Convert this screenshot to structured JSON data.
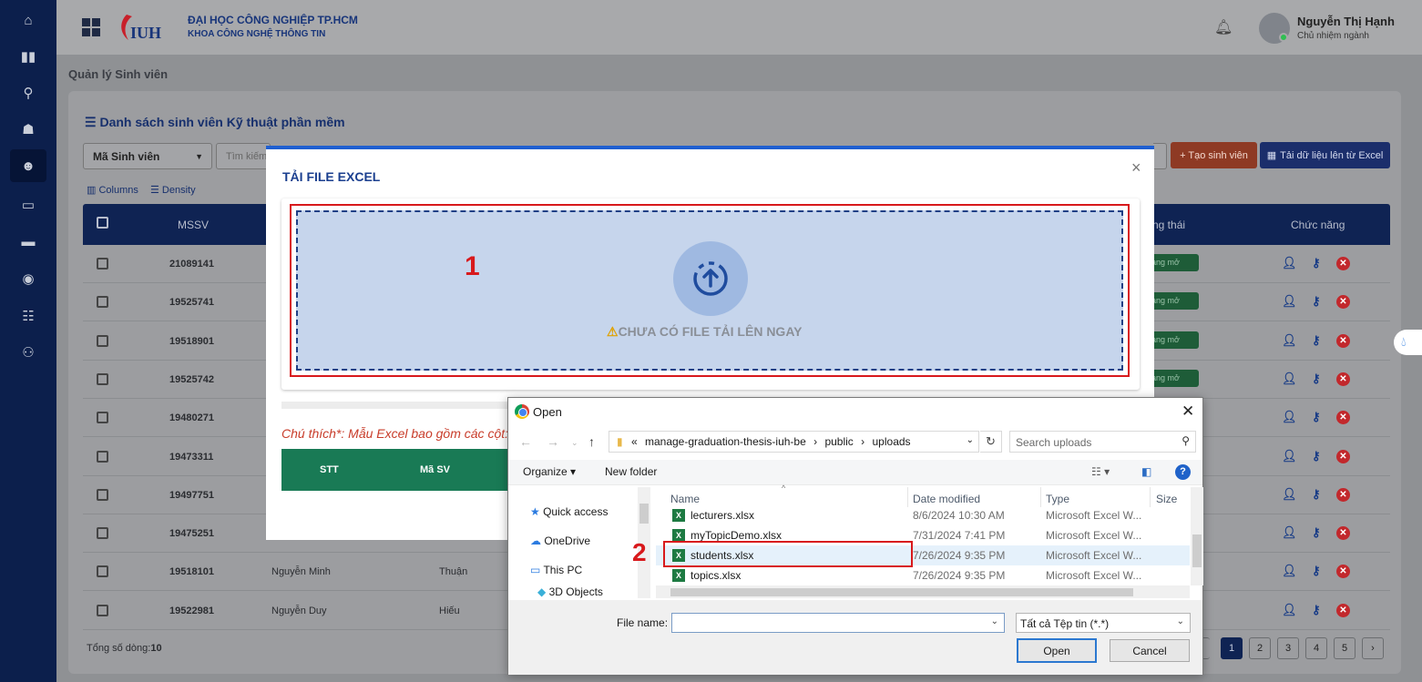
{
  "header": {
    "university": "ĐẠI HỌC CÔNG NGHIỆP TP.HCM",
    "faculty": "KHOA CÔNG NGHỆ THÔNG TIN",
    "logo_text": "IUH",
    "user_name": "Nguyễn Thị Hạnh",
    "user_role": "Chủ nhiệm ngành"
  },
  "page": {
    "breadcrumb": "Quản lý Sinh viên",
    "title": "Danh sách sinh viên Kỹ thuật phần mềm",
    "filter_select": "Mã Sinh viên",
    "search_placeholder": "Tìm kiếm",
    "btn_create": "+ Tạo sinh viên",
    "btn_upload": "Tải dữ liệu lên từ Excel",
    "columns_label": "Columns",
    "density_label": "Density"
  },
  "table": {
    "headers": {
      "mssv": "MSSV",
      "status": "ng thái",
      "actions": "Chức năng"
    },
    "rows": [
      {
        "mssv": "21089141",
        "ho": "",
        "ten": "",
        "status": "ang mở"
      },
      {
        "mssv": "19525741",
        "ho": "",
        "ten": "",
        "status": "ang mở"
      },
      {
        "mssv": "19518901",
        "ho": "",
        "ten": "",
        "status": "ang mở"
      },
      {
        "mssv": "19525742",
        "ho": "",
        "ten": "",
        "status": "ang mở"
      },
      {
        "mssv": "19480271",
        "ho": "",
        "ten": "",
        "status": ""
      },
      {
        "mssv": "19473311",
        "ho": "",
        "ten": "",
        "status": ""
      },
      {
        "mssv": "19497751",
        "ho": "",
        "ten": "",
        "status": ""
      },
      {
        "mssv": "19475251",
        "ho": "",
        "ten": "",
        "status": ""
      },
      {
        "mssv": "19518101",
        "ho": "Nguyễn Minh",
        "ten": "Thuận",
        "status": ""
      },
      {
        "mssv": "19522981",
        "ho": "Nguyễn Duy",
        "ten": "Hiếu",
        "status": ""
      }
    ],
    "total_label": "Tổng số dòng:",
    "total_value": "10",
    "pages": [
      "1",
      "2",
      "3",
      "4",
      "5"
    ],
    "next": "›"
  },
  "modal": {
    "title": "TẢI FILE EXCEL",
    "close": "×",
    "no_file": "CHƯA CÓ FILE TẢI LÊN NGAY",
    "warning_icon": "⚠",
    "note": "Chú thích*: Mẫu Excel bao gồm các cột:",
    "col_stt": "STT",
    "col_masv": "Mã SV"
  },
  "annotations": {
    "one": "1",
    "two": "2"
  },
  "dialog": {
    "title": "Open",
    "close": "✕",
    "path_prefix": "«",
    "path": [
      "manage-graduation-thesis-iuh-be",
      "public",
      "uploads"
    ],
    "path_sep": "›",
    "search_placeholder": "Search uploads",
    "organize": "Organize ▾",
    "new_folder": "New folder",
    "help": "?",
    "nav": [
      "Quick access",
      "OneDrive",
      "This PC",
      "3D Objects"
    ],
    "columns": {
      "name": "Name",
      "date": "Date modified",
      "type": "Type",
      "size": "Size"
    },
    "files": [
      {
        "name": "lecturers.xlsx",
        "date": "8/6/2024 10:30 AM",
        "type": "Microsoft Excel W..."
      },
      {
        "name": "myTopicDemo.xlsx",
        "date": "7/31/2024 7:41 PM",
        "type": "Microsoft Excel W..."
      },
      {
        "name": "students.xlsx",
        "date": "7/26/2024 9:35 PM",
        "type": "Microsoft Excel W..."
      },
      {
        "name": "topics.xlsx",
        "date": "7/26/2024 9:35 PM",
        "type": "Microsoft Excel W..."
      }
    ],
    "file_name_label": "File name:",
    "file_name_value": "",
    "file_type": "Tất cả Tệp tin (*.*)",
    "btn_open": "Open",
    "btn_cancel": "Cancel"
  }
}
